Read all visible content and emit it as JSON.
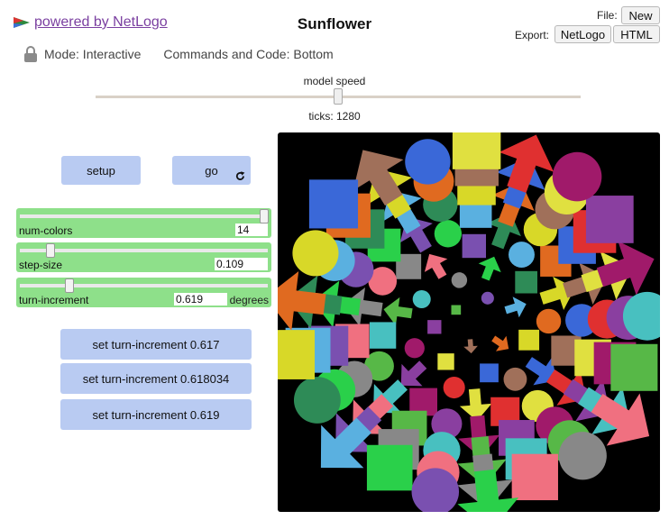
{
  "header": {
    "logo_text": "powered by NetLogo",
    "title": "Sunflower",
    "file_label": "File:",
    "new_label": "New",
    "export_label": "Export:",
    "export_netlogo_label": "NetLogo",
    "export_html_label": "HTML"
  },
  "status": {
    "mode": "Mode: Interactive",
    "commands": "Commands and Code: Bottom"
  },
  "speed": {
    "label": "model speed",
    "ticks": "ticks: 1280",
    "level": 0.5
  },
  "buttons": {
    "setup": "setup",
    "go": "go",
    "set1": "set turn-increment 0.617",
    "set2": "set turn-increment 0.618034",
    "set3": "set turn-increment 0.619"
  },
  "sliders": [
    {
      "name": "num-colors",
      "value": "14",
      "units": "",
      "fraction": 1.0
    },
    {
      "name": "step-size",
      "value": "0.109",
      "units": "",
      "fraction": 0.11
    },
    {
      "name": "turn-increment",
      "value": "0.619",
      "units": "degrees",
      "fraction": 0.21
    }
  ],
  "view": {
    "background": "#000000"
  }
}
